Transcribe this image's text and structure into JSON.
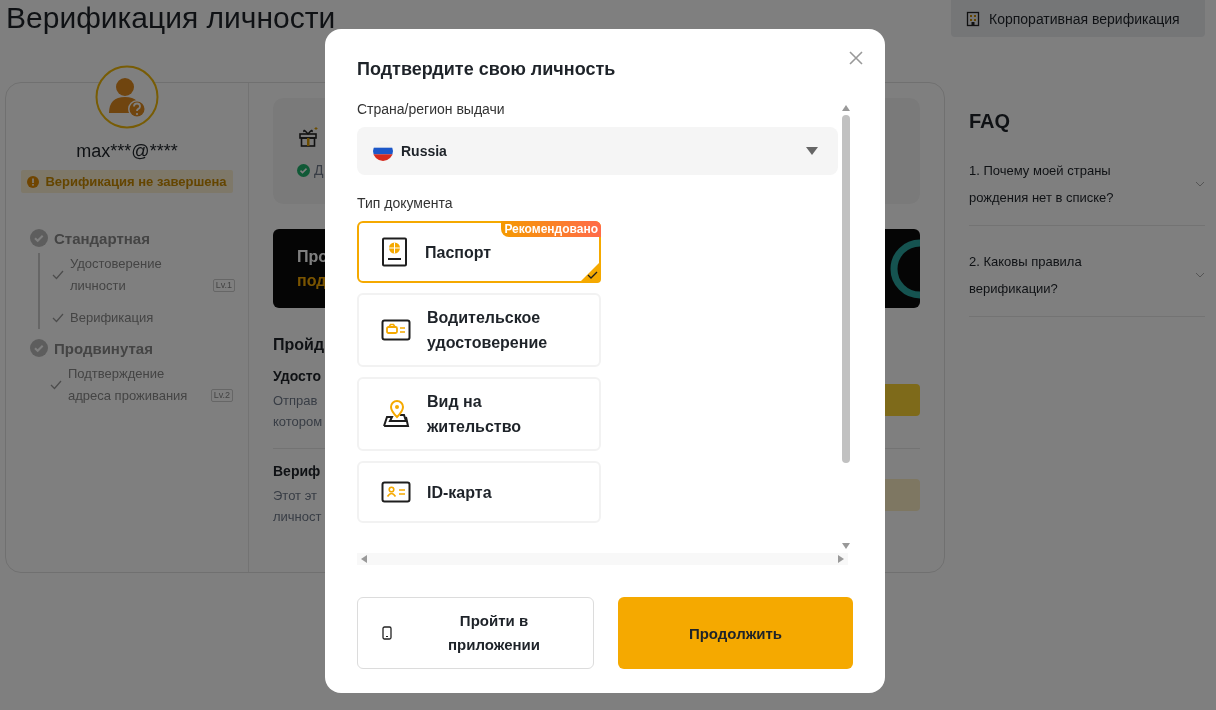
{
  "page": {
    "title": "Верификация личности",
    "corporate_button": "Корпоративная верификация"
  },
  "profile": {
    "email": "max***@****",
    "status": "Верификация не завершена"
  },
  "levels": [
    {
      "name": "Стандартная",
      "steps": [
        {
          "label": "Удостоверение личности",
          "tag": "Lv.1"
        },
        {
          "label": "Верификация"
        }
      ]
    },
    {
      "name": "Продвинутая",
      "steps": [
        {
          "label": "Подтверждение адреса проживания",
          "tag": "Lv.2"
        }
      ]
    }
  ],
  "main": {
    "reward_text": "Д",
    "banner_lines": [
      "Про",
      "под"
    ],
    "section_title": "Пройд",
    "items": [
      {
        "title": "Удосто",
        "lines": [
          "Отправ",
          "котором"
        ],
        "disabled": false
      },
      {
        "title": "Вериф",
        "lines": [
          "Этот эт",
          "личност"
        ],
        "disabled": true
      }
    ]
  },
  "faq": {
    "title": "FAQ",
    "items": [
      "1. Почему моей страны рождения нет в списке?",
      "2. Каковы правила верификации?"
    ]
  },
  "modal": {
    "title": "Подтвердите свою личность",
    "country_label": "Страна/регион выдачи",
    "country": "Russia",
    "document_label": "Тип документа",
    "documents": [
      {
        "label": "Паспорт",
        "kind": "passport",
        "selected": true,
        "badge": "Рекомендовано"
      },
      {
        "label": "Водительское удостоверение",
        "kind": "license",
        "selected": false
      },
      {
        "label": "Вид на жительство",
        "kind": "residence",
        "selected": false
      },
      {
        "label": "ID-карта",
        "kind": "id",
        "selected": false
      }
    ],
    "buttons": [
      {
        "label": "Пройти в приложении",
        "kind": "app"
      },
      {
        "label": "Продолжить",
        "kind": "primary"
      }
    ]
  }
}
